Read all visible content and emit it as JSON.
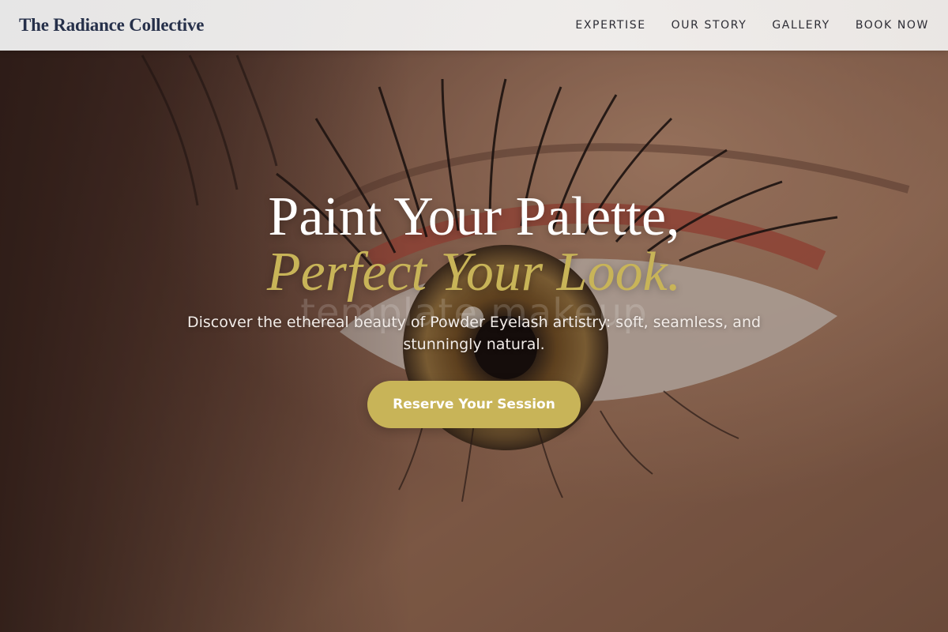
{
  "header": {
    "brand": "The Radiance Collective",
    "nav": [
      {
        "label": "EXPERTISE"
      },
      {
        "label": "OUR STORY"
      },
      {
        "label": "GALLERY"
      },
      {
        "label": "BOOK NOW"
      }
    ]
  },
  "hero": {
    "headline_line1": "Paint Your Palette,",
    "headline_line2": "Perfect Your Look.",
    "background_watermark": "template makeup",
    "subtext": "Discover the ethereal beauty of Powder Eyelash artistry: soft, seamless, and stunningly natural.",
    "cta_label": "Reserve Your Session",
    "background_image": "eye-closeup-photo"
  },
  "colors": {
    "accent_gold": "#c8b458",
    "brand_navy": "#26304a",
    "header_bg": "#f2f1f0"
  }
}
